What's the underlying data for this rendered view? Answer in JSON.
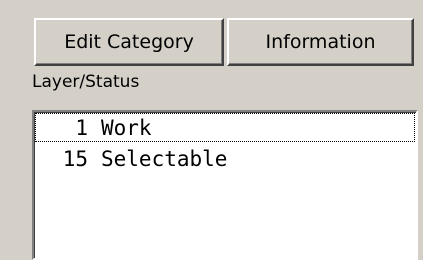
{
  "toolbar": {
    "edit_category_label": "Edit Category",
    "information_label": "Information"
  },
  "layer_status": {
    "label": "Layer/Status",
    "items": [
      {
        "number": "1",
        "name": "Work"
      },
      {
        "number": "15",
        "name": "Selectable"
      }
    ]
  }
}
